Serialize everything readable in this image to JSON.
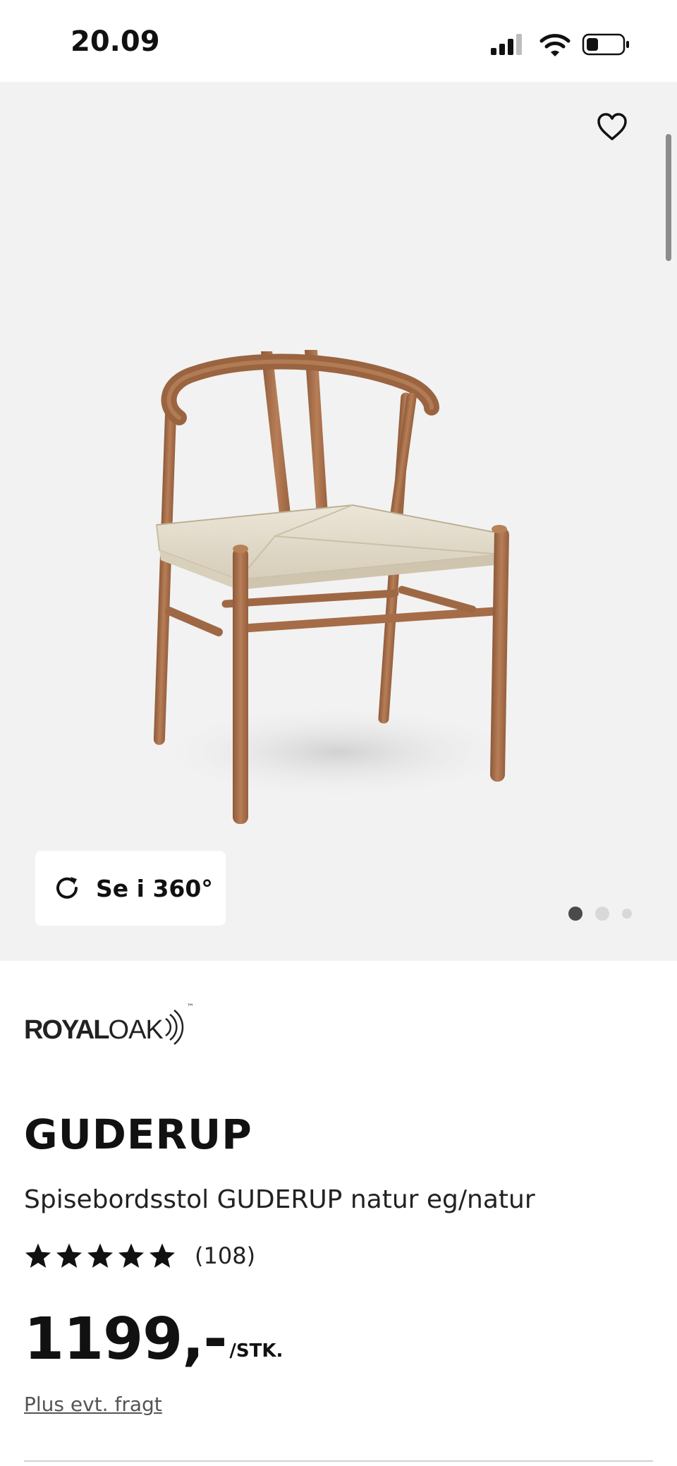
{
  "status_bar": {
    "time": "20.09",
    "icons": [
      "signal-icon",
      "wifi-icon",
      "battery-icon"
    ]
  },
  "gallery": {
    "favorite_icon": "heart-outline-icon",
    "view_360_label": "Se i 360°",
    "view_360_icon": "rotate-icon",
    "image_count": 3,
    "active_image_index": 0
  },
  "product": {
    "brand_part1": "ROYAL",
    "brand_part2": "OAK",
    "brand_tm": "™",
    "name": "GUDERUP",
    "description": "Spisebordsstol GUDERUP natur eg/natur",
    "rating_stars": 5,
    "review_count": "(108)",
    "price": "1199,-",
    "price_unit": "/STK.",
    "shipping_note": "Plus evt. fragt"
  },
  "colors": {
    "gallery_background": "#f2f2f2",
    "text": "#111111",
    "wood": "#a9714b",
    "seat_cord": "#e3dccd"
  }
}
